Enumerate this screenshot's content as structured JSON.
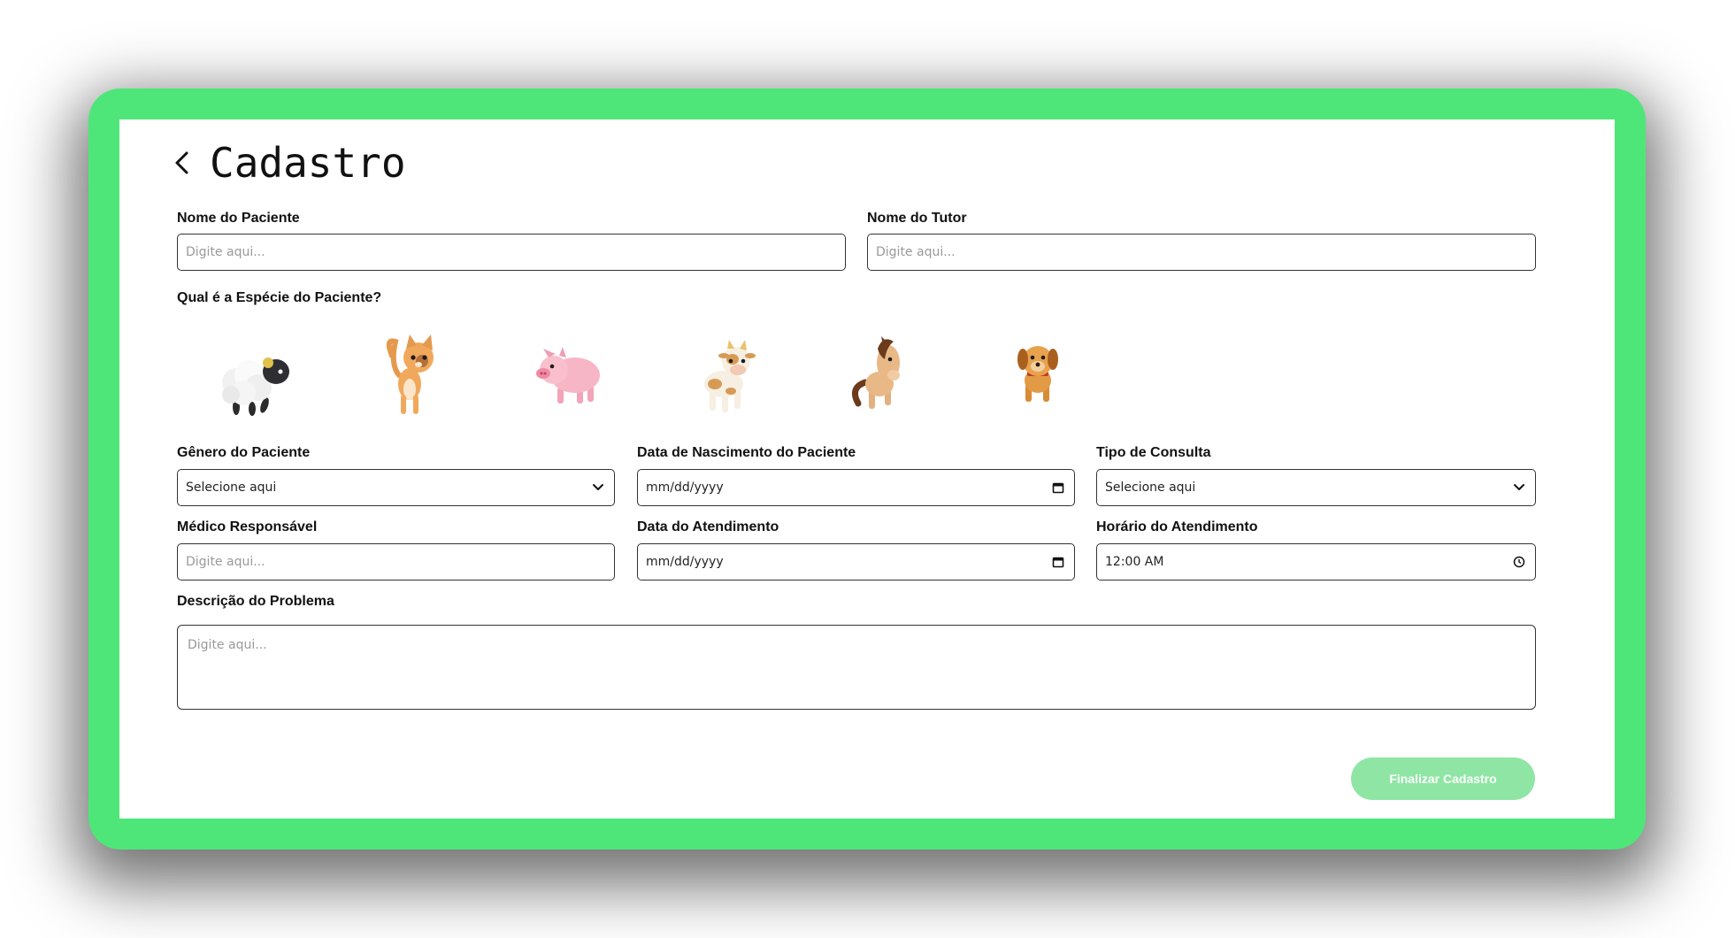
{
  "page": {
    "title": "Cadastro",
    "back_icon": "chevron-left-icon",
    "colors": {
      "frame": "#4fe679",
      "button": "#8fe6a4"
    }
  },
  "form": {
    "patient_name": {
      "label": "Nome do Paciente",
      "placeholder": "Digite aqui..."
    },
    "tutor_name": {
      "label": "Nome do Tutor",
      "placeholder": "Digite aqui..."
    },
    "species": {
      "label": "Qual é a Espécie do Paciente?",
      "options": [
        "sheep-icon",
        "cat-icon",
        "pig-icon",
        "cow-icon",
        "horse-icon",
        "dog-icon"
      ]
    },
    "gender": {
      "label": "Gênero do Paciente",
      "value": "Selecione aqui"
    },
    "birth_date": {
      "label": "Data de Nascimento do Paciente",
      "value": "mm/dd/yyyy"
    },
    "consult_type": {
      "label": "Tipo de Consulta",
      "value": "Selecione aqui"
    },
    "doctor": {
      "label": "Médico Responsável",
      "placeholder": "Digite aqui..."
    },
    "appointment_date": {
      "label": "Data do Atendimento",
      "value": "mm/dd/yyyy"
    },
    "appointment_time": {
      "label": "Horário do Atendimento",
      "value": "12:00 AM"
    },
    "description": {
      "label": "Descrição do Problema",
      "placeholder": "Digite aqui..."
    },
    "submit_label": "Finalizar Cadastro"
  }
}
